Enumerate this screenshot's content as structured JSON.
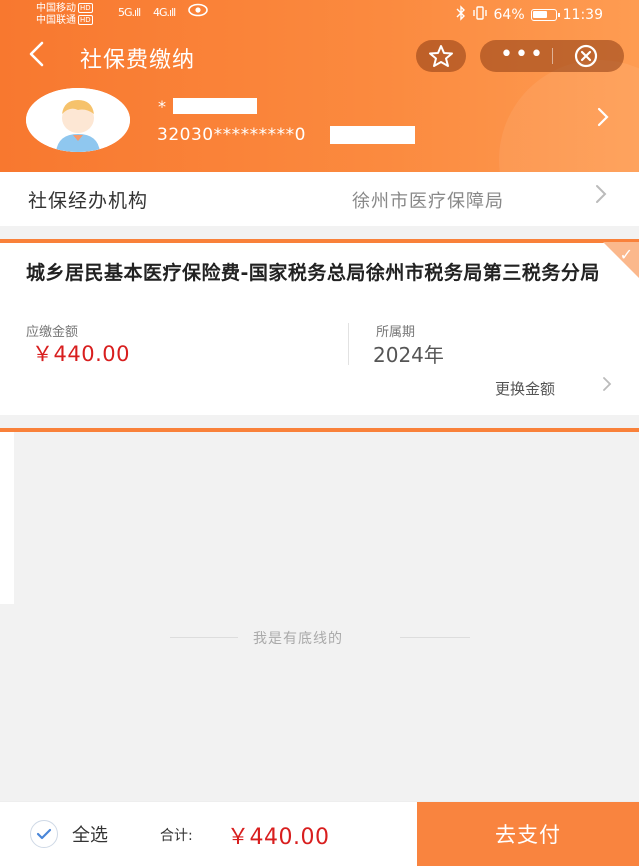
{
  "status_bar": {
    "carrier1": "中国移动",
    "carrier2": "中国联通",
    "hd_badge": "HD",
    "signal1": "5G",
    "signal2": "4G",
    "battery": "64%",
    "time": "11:39"
  },
  "nav": {
    "back_icon": "<",
    "title": "社保费缴纳",
    "star_icon": "star-icon",
    "more_icon": "•••",
    "close_icon": "close-circle-icon"
  },
  "profile": {
    "name": "*",
    "id_number": "32030*********0",
    "arrow": ">"
  },
  "agency": {
    "label": "社保经办机构",
    "value": "徐州市医疗保障局",
    "arrow": ">"
  },
  "bill": {
    "title": "城乡居民基本医疗保险费-国家税务总局徐州市税务局第三税务分局",
    "amount_label": "应缴金额",
    "amount": "￥440.00",
    "period_label": "所属期",
    "period": "2024年",
    "change_label": "更换金额",
    "change_arrow": ">",
    "check_mark": "✓"
  },
  "footer_note": "我是有底线的",
  "bottom": {
    "select_all": "全选",
    "total_label": "合计:",
    "total_amount": "￥440.00",
    "pay_button": "去支付"
  },
  "colors": {
    "accent": "#f9813a",
    "price": "#d81e1e"
  }
}
